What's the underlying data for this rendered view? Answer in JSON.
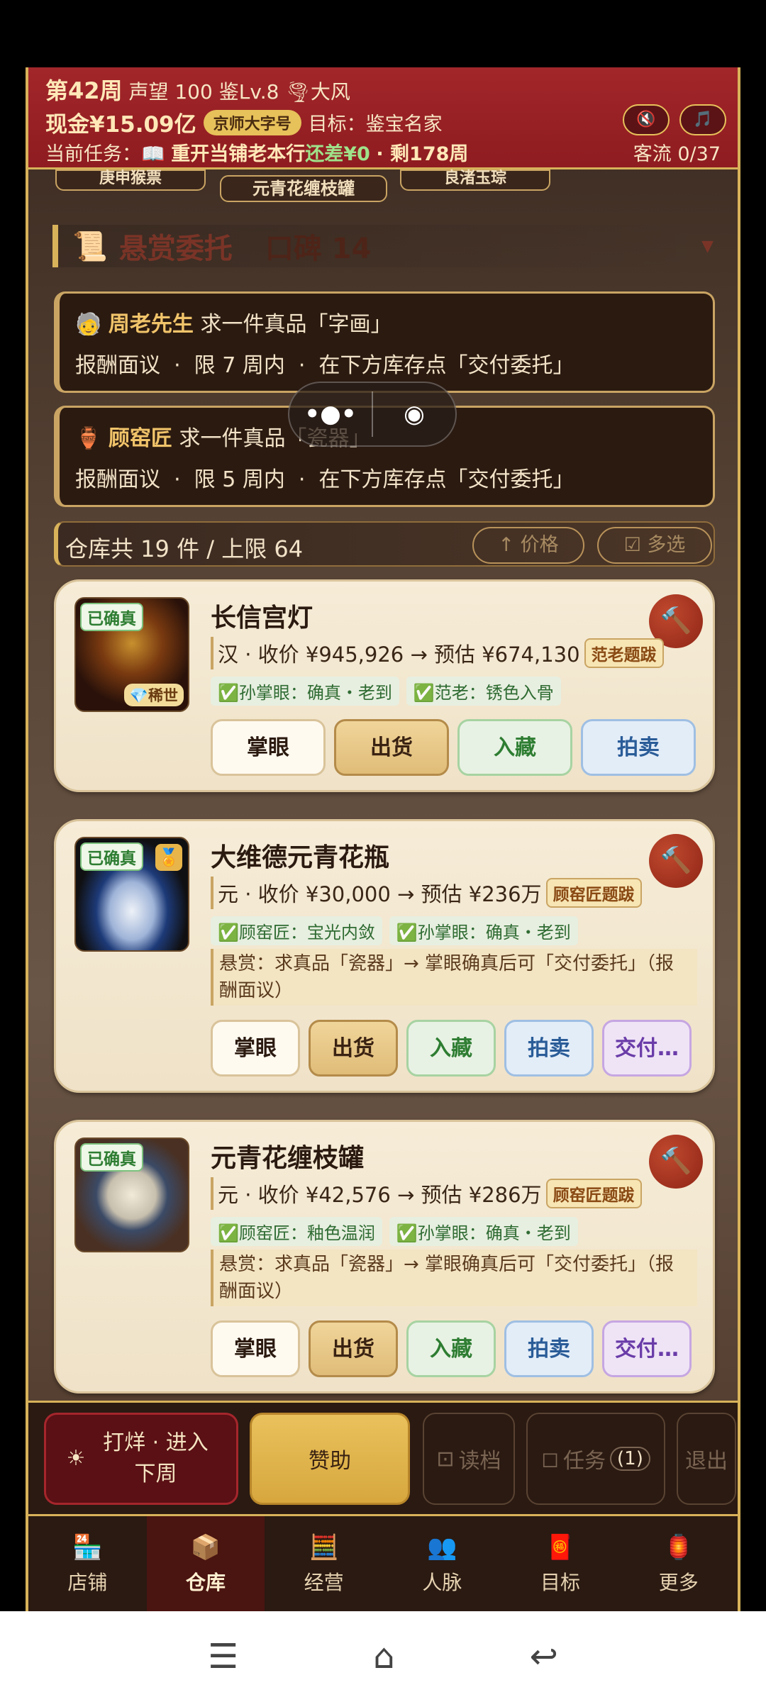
{
  "header": {
    "week": "第42周",
    "fame": "声望 100",
    "appraise_level": "鉴Lv.8",
    "weather_icon": "tornado-icon",
    "weather": "大风",
    "cash": "现金¥15.09亿",
    "chip": "京师大字号",
    "goal": "目标：鉴宝名家",
    "task_prefix": "当前任务：",
    "task_icon": "book-icon",
    "task": "重开当铺老本行",
    "task_shortfall": "还差¥0",
    "task_remain": "· 剩178周",
    "sound_icon": "mute-icon",
    "music_icon": "music-icon",
    "traffic": "客流 0/37"
  },
  "tags": [
    "庚申猴票",
    "元青花缠枝罐",
    "良渚玉琮"
  ],
  "bounty": {
    "icon": "scroll-icon",
    "title": "悬赏委托",
    "reputation": "口碑 14",
    "items": [
      {
        "icon": "old-man-icon",
        "client": "周老先生",
        "request": "求一件真品「字画」",
        "detail": "报酬面议  ·  限 7 周内  ·  在下方库存点「交付委托」"
      },
      {
        "icon": "vase-icon",
        "client": "顾窑匠",
        "request": "求一件真品「瓷器」",
        "detail": "报酬面议  ·  限 5 周内  ·  在下方库存点「交付委托」"
      }
    ]
  },
  "capsule": {
    "more": "•●•",
    "close_icon": "target-close-icon"
  },
  "warehouse": {
    "summary": "仓库共 19 件 / 上限 64",
    "sort_label": "↑ 价格",
    "multi_label": "☑ 多选"
  },
  "items": [
    {
      "name": "长信宫灯",
      "verified": "已确真",
      "rarity": "💎稀世",
      "price_line": "汉 · 收价 ¥945,926 → 预估 ¥674,130",
      "seal": "范老题跋",
      "notes": [
        "✅孙掌眼：确真・老到",
        "✅范老：锈色入骨"
      ],
      "reward": "",
      "actions": [
        "掌眼",
        "出货",
        "入藏",
        "拍卖"
      ]
    },
    {
      "name": "大维德元青花瓶",
      "verified": "已确真",
      "medal": "🏅",
      "price_line": "元 · 收价 ¥30,000 → 预估 ¥236万",
      "seal": "顾窑匠题跋",
      "notes": [
        "✅顾窑匠：宝光内敛",
        "✅孙掌眼：确真・老到"
      ],
      "reward": "悬赏：求真品「瓷器」→ 掌眼确真后可「交付委托」（报酬面议）",
      "actions": [
        "掌眼",
        "出货",
        "入藏",
        "拍卖",
        "交付…"
      ]
    },
    {
      "name": "元青花缠枝罐",
      "verified": "已确真",
      "price_line": "元 · 收价 ¥42,576 → 预估 ¥286万",
      "seal": "顾窑匠题跋",
      "notes": [
        "✅顾窑匠：釉色温润",
        "✅孙掌眼：确真・老到"
      ],
      "reward": "悬赏：求真品「瓷器」→ 掌眼确真后可「交付委托」（报酬面议）",
      "actions": [
        "掌眼",
        "出货",
        "入藏",
        "拍卖",
        "交付…"
      ]
    }
  ],
  "footer": {
    "next_week": "打烊 · 进入下周",
    "sponsor": "赞助",
    "load": "读档",
    "task": "任务",
    "task_count": "(1)",
    "quit": "退出"
  },
  "tabs": [
    {
      "label": "店铺",
      "icon": "shop-icon"
    },
    {
      "label": "仓库",
      "icon": "warehouse-icon",
      "active": true
    },
    {
      "label": "经营",
      "icon": "abacus-icon"
    },
    {
      "label": "人脉",
      "icon": "people-icon"
    },
    {
      "label": "目标",
      "icon": "scroll-target-icon"
    },
    {
      "label": "更多",
      "icon": "more-icon"
    }
  ]
}
